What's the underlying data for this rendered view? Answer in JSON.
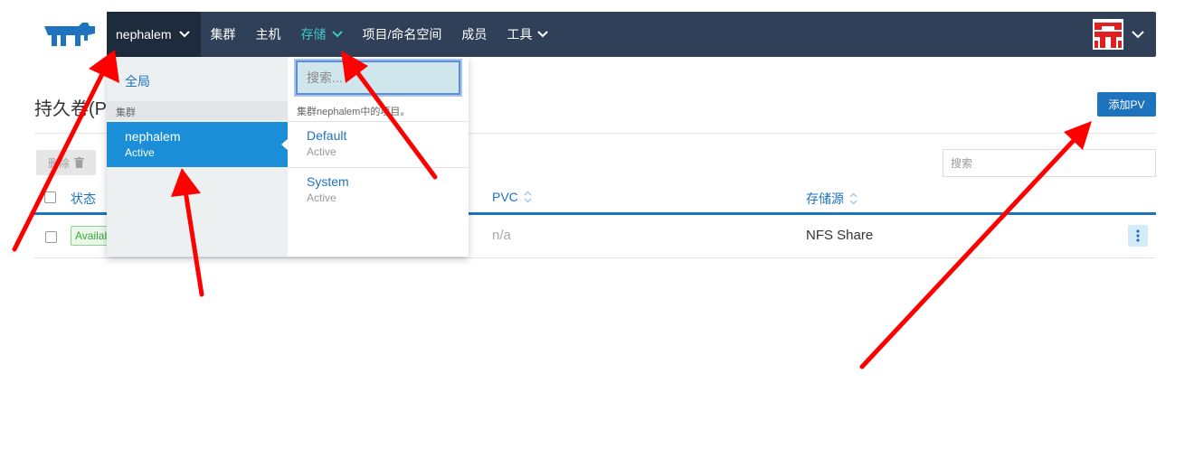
{
  "nav": {
    "cluster_selector": "nephalem",
    "items": [
      {
        "label": "集群"
      },
      {
        "label": "主机"
      },
      {
        "label": "存储",
        "active": true
      },
      {
        "label": "项目/命名空间"
      },
      {
        "label": "成员"
      },
      {
        "label": "工具"
      }
    ]
  },
  "page": {
    "title": "持久卷(P",
    "add_button": "添加PV",
    "delete_button": "删除",
    "search_placeholder": "搜索"
  },
  "table": {
    "headers": {
      "status": "状态",
      "pvc": "PVC",
      "storage": "存储源"
    },
    "rows": [
      {
        "status": "Available",
        "pvc": "n/a",
        "storage": "NFS Share"
      }
    ]
  },
  "dropdown": {
    "global": "全局",
    "section_label": "集群",
    "cluster": {
      "name": "nephalem",
      "state": "Active"
    },
    "search_placeholder": "搜索...",
    "note": "集群nephalem中的项目。",
    "projects": [
      {
        "name": "Default",
        "state": "Active"
      },
      {
        "name": "System",
        "state": "Active"
      }
    ]
  },
  "colors": {
    "nav_bg": "#2f4058",
    "accent": "#1e73be",
    "active_nav": "#3dc7c7",
    "selected": "#1a8fd8",
    "annotation": "#ff0000"
  }
}
